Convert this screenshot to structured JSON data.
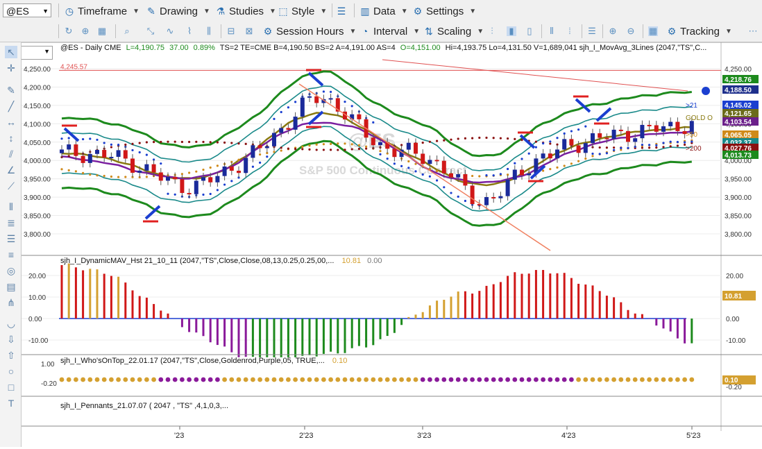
{
  "toolbar1": {
    "symbol": "@ES",
    "items": [
      {
        "label": "Timeframe",
        "icon": "timeframe-icon"
      },
      {
        "label": "Drawing",
        "icon": "pencil-icon"
      },
      {
        "label": "Studies",
        "icon": "studies-icon"
      },
      {
        "label": "Style",
        "icon": "style-icon"
      },
      {
        "label": "Data",
        "icon": "data-icon"
      },
      {
        "label": "Settings",
        "icon": "gear-icon"
      }
    ]
  },
  "toolbar2": {
    "items": [
      {
        "label": "Session Hours",
        "icon": "session-hours-icon"
      },
      {
        "label": "Interval",
        "icon": "interval-icon"
      },
      {
        "label": "Scaling",
        "icon": "scaling-icon"
      },
      {
        "label": "Tracking",
        "icon": "tracking-icon"
      }
    ]
  },
  "chart": {
    "header": {
      "prefix": "@ES - Daily  CME",
      "last": "L=4,190.75",
      "change": "37.00",
      "pct": "0.89%",
      "rest": "TS=2  TE=CME  B=4,190.50  BS=2  A=4,191.00  AS=4",
      "open": "O=4,151.00",
      "tail": "Hi=4,193.75  Lo=4,131.50  V=1,689,041  sjh_I_MovAvg_3Lines (2047,\"TS\",C..."
    },
    "watermark_symbol": "@ES",
    "watermark_name": "S&P 500 Continuous Contract",
    "hline_label": "4,245.57",
    "price_axis_left": [
      "4,250.00",
      "4,200.00",
      "4,150.00",
      "4,100.00",
      "4,050.00",
      "4,000.00",
      "3,950.00",
      "3,900.00",
      "3,850.00",
      "3,800.00"
    ],
    "price_axis_right": [
      "4,250.00",
      "4,150.00",
      "4,100.00",
      "4,050.00",
      "4,000.00",
      "3,950.00",
      "3,900.00",
      "3,850.00",
      "3,800.00"
    ],
    "right_tags": [
      {
        "text": "4,218.76",
        "color": "#1d8a1d"
      },
      {
        "text": "4,188.50",
        "color": "#1e2f8c"
      },
      {
        "text": "4,145.02",
        "color": "#1b3fd0"
      },
      {
        "text": "4,121.65",
        "color": "#6b6b1a"
      },
      {
        "text": "4,103.54",
        "color": "#6b1f8a"
      },
      {
        "text": "4,065.05",
        "color": "#d08a1a"
      },
      {
        "text": "4,032.37",
        "color": "#1a8a8a"
      },
      {
        "text": "4,027.76",
        "color": "#8a1010"
      },
      {
        "text": "4,013.73",
        "color": "#1d8a1d"
      }
    ],
    "ma_labels": [
      {
        "text": ">21",
        "color": "#1b3fd0"
      },
      {
        "text": "GOLD O",
        "color": "#8a7a10"
      },
      {
        "text": ">50",
        "color": "#d08a1a"
      },
      {
        "text": ">200",
        "color": "#8a1010"
      }
    ],
    "date_labels": [
      "'23",
      "2'23",
      "3'23",
      "4'23",
      "5'23"
    ]
  },
  "panel2": {
    "title": "sjh_I_DynamicMAV_Hst 21_10_11 (2047,\"TS\",Close,Close,08,13,0.25,0.25,00,...",
    "v1": "10.81",
    "v2": "0.00",
    "axis": [
      "20.00",
      "10.00",
      "0.00",
      "-10.00"
    ],
    "last_tag": "10.81"
  },
  "panel3": {
    "title": "sjh_I_Who'sOnTop_22.01.17 (2047,\"TS\",Close,Goldenrod,Purple,05, TRUE,...",
    "v1": "0.10",
    "axis_left": [
      "1.00",
      "-0.20"
    ],
    "axis_right": [
      "-0.20"
    ],
    "last_tag": "0.10"
  },
  "panel4": {
    "title": "sjh_I_Pennants_21.07.07 ( 2047 , \"TS\" ,4,1,0,3,..."
  },
  "colors": {
    "up": "#1a2a9a",
    "down": "#d01818",
    "band_outer": "#1d8a1d",
    "band_inner": "#1a8a8a",
    "hist_red": "#d01818",
    "hist_gold": "#d4a030",
    "hist_green": "#1d8a1d",
    "hist_purple": "#8a1a9a"
  }
}
